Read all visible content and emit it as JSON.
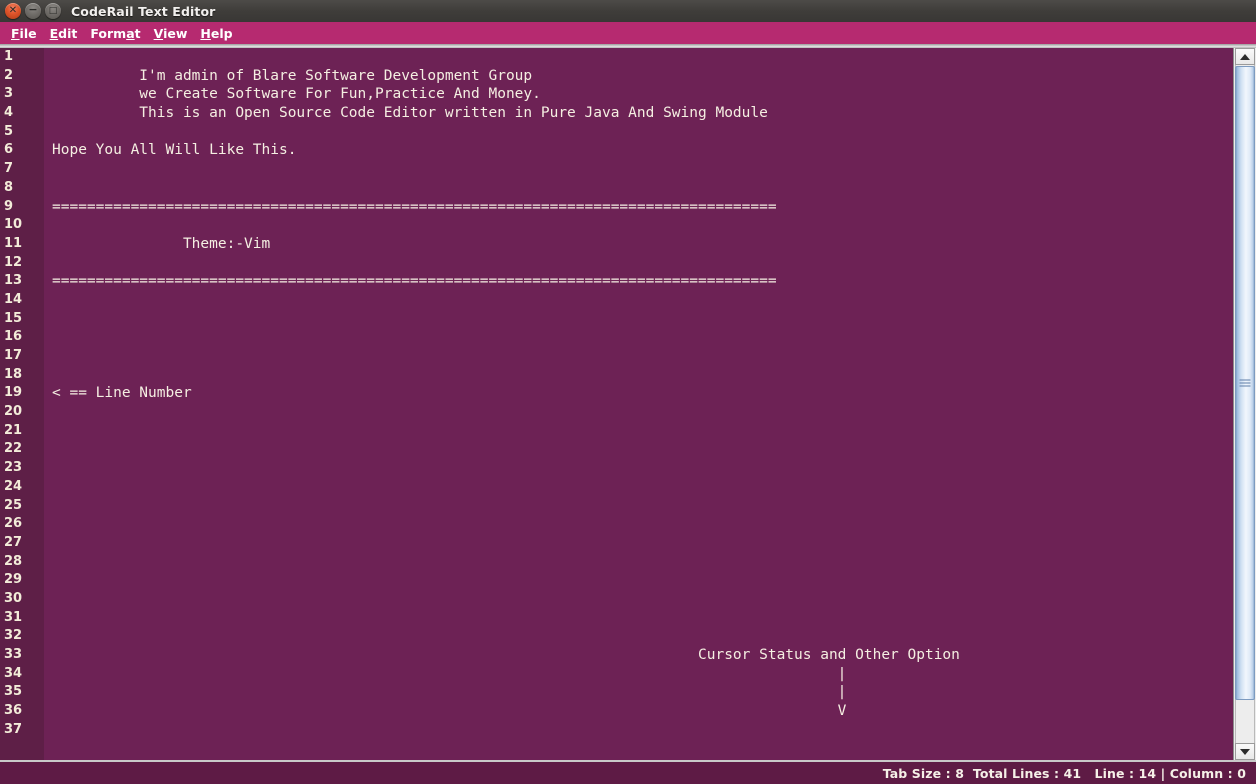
{
  "window": {
    "title": "CodeRail Text Editor",
    "controls": [
      {
        "name": "close",
        "glyph": "✕"
      },
      {
        "name": "minimize",
        "glyph": "−"
      },
      {
        "name": "maximize",
        "glyph": "□"
      }
    ]
  },
  "menubar": {
    "items": [
      {
        "label": "File",
        "pre": "",
        "mnemonic": "F",
        "post": "ile"
      },
      {
        "label": "Edit",
        "pre": "",
        "mnemonic": "E",
        "post": "dit"
      },
      {
        "label": "Format",
        "pre": "Form",
        "mnemonic": "a",
        "post": "t"
      },
      {
        "label": "View",
        "pre": "",
        "mnemonic": "V",
        "post": "iew"
      },
      {
        "label": "Help",
        "pre": "",
        "mnemonic": "H",
        "post": "elp"
      }
    ]
  },
  "editor": {
    "line_numbers": [
      "1",
      "2",
      "3",
      "4",
      "5",
      "6",
      "7",
      "8",
      "9",
      "10",
      "11",
      "12",
      "13",
      "14",
      "15",
      "16",
      "17",
      "18",
      "19",
      "20",
      "21",
      "22",
      "23",
      "24",
      "25",
      "26",
      "27",
      "28",
      "29",
      "30",
      "31",
      "32",
      "33",
      "34",
      "35",
      "36",
      "37"
    ],
    "lines": [
      "",
      "          I'm admin of Blare Software Development Group",
      "          we Create Software For Fun,Practice And Money.",
      "          This is an Open Source Code Editor written in Pure Java And Swing Module",
      "",
      "Hope You All Will Like This.",
      "",
      "",
      "===================================================================================",
      "",
      "               Theme:-Vim",
      "",
      "===================================================================================",
      "",
      "",
      "",
      "",
      "",
      "< == Line Number",
      "",
      "",
      "",
      "",
      "",
      "",
      "",
      "",
      "",
      "",
      "",
      "",
      "",
      "                                                                          Cursor Status and Other Option",
      "                                                                                          |",
      "                                                                                          |",
      "                                                                                          V",
      ""
    ]
  },
  "scrollbar": {
    "up_arrow": "▲",
    "down_arrow": "▼"
  },
  "statusbar": {
    "text": "Tab Size : 8  Total Lines : 41   Line : 14 | Column : 0",
    "tab_size": "8",
    "total_lines": "41",
    "line": "14",
    "column": "0"
  },
  "colors": {
    "editor_bg": "#6d2255",
    "gutter_bg": "#5e1f47",
    "menubar_bg": "#b62a70",
    "statusbar_bg": "#5e1b45",
    "text_fg": "#f5efe2"
  }
}
